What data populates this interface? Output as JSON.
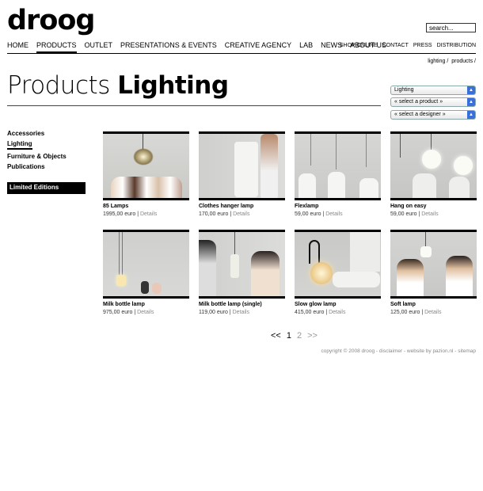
{
  "brand": "droog",
  "search": {
    "value": "search..."
  },
  "nav": [
    {
      "label": "HOME"
    },
    {
      "label": "PRODUCTS"
    },
    {
      "label": "OUTLET"
    },
    {
      "label": "PRESENTATIONS & EVENTS"
    },
    {
      "label": "CREATIVE AGENCY"
    },
    {
      "label": "LAB"
    },
    {
      "label": "NEWS"
    },
    {
      "label": "ABOUT US"
    }
  ],
  "right_nav": [
    "SHOP ONLINE",
    "CONTACT",
    "PRESS",
    "DISTRIBUTION"
  ],
  "breadcrumb": [
    "lighting /",
    "products /"
  ],
  "title": {
    "light": "Products",
    "bold": "Lighting"
  },
  "selects": [
    "Lighting",
    "« select a product »",
    "« select a designer »"
  ],
  "sidebar": [
    {
      "label": "Accessories"
    },
    {
      "label": "Lighting"
    },
    {
      "label": "Furniture & Objects"
    },
    {
      "label": "Publications"
    }
  ],
  "limited": "Limited Editions",
  "products": [
    {
      "name": "85 Lamps",
      "price": "1995,00 euro",
      "details": "Details"
    },
    {
      "name": "Clothes hanger lamp",
      "price": "170,00 euro",
      "details": "Details"
    },
    {
      "name": "Flexlamp",
      "price": "59,00 euro",
      "details": "Details"
    },
    {
      "name": "Hang on easy",
      "price": "59,00 euro",
      "details": "Details"
    },
    {
      "name": "Milk bottle lamp",
      "price": "975,00 euro",
      "details": "Details"
    },
    {
      "name": "Milk bottle lamp (single)",
      "price": "119,00 euro",
      "details": "Details"
    },
    {
      "name": "Slow glow lamp",
      "price": "415,00 euro",
      "details": "Details"
    },
    {
      "name": "Soft lamp",
      "price": "125,00 euro",
      "details": "Details"
    }
  ],
  "pager": {
    "prev": "<<",
    "current": "1",
    "next_page": "2",
    "next": ">>"
  },
  "footer": "copyright © 2008 droog  -  disclaimer  -  website by pazion.nl  -  sitemap"
}
